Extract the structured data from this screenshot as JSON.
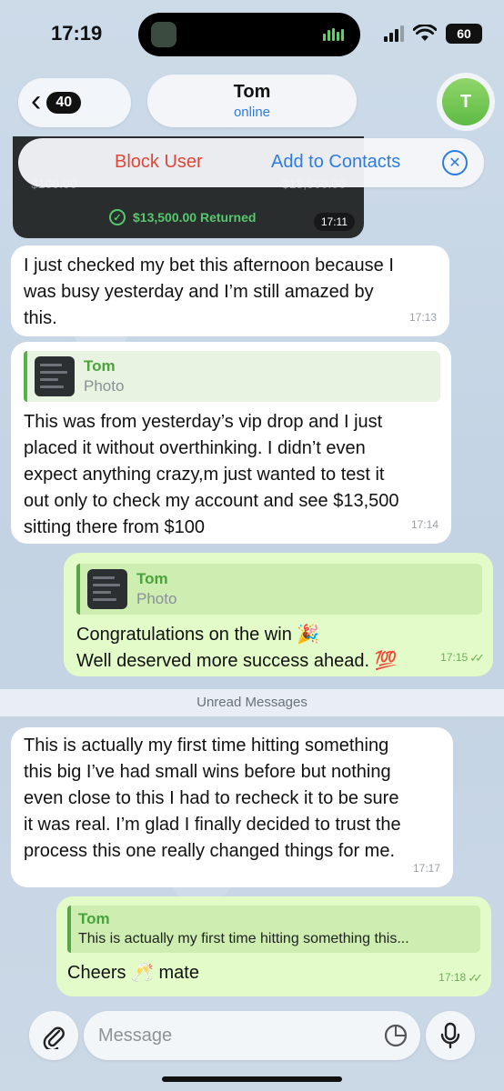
{
  "status_bar": {
    "time": "17:19",
    "battery": "60"
  },
  "header": {
    "back_count": "40",
    "name": "Tom",
    "status": "online",
    "avatar_initial": "T"
  },
  "actions": {
    "block": "Block User",
    "add": "Add to Contacts"
  },
  "photo_message": {
    "faded_left": "$100.00",
    "faded_right": "$13,500.00",
    "returned_text": "$13,500.00 Returned",
    "time": "17:11"
  },
  "messages": [
    {
      "direction": "incoming",
      "text": "I just checked my bet this afternoon because I\nwas busy yesterday and  I’m still amazed by\nthis.",
      "time": "17:13"
    },
    {
      "direction": "incoming",
      "reply": {
        "name": "Tom",
        "sub": "Photo"
      },
      "text": "This was from yesterday’s vip drop and I just\nplaced it without overthinking. I didn’t even\nexpect anything crazy,m just wanted to test it\nout only to check my account and see $13,500\nsitting there from $100",
      "time": "17:14"
    },
    {
      "direction": "outgoing",
      "reply": {
        "name": "Tom",
        "sub": "Photo"
      },
      "text": "Congratulations on the win 🎉\nWell deserved more success ahead. 💯",
      "time": "17:15"
    },
    {
      "direction": "incoming",
      "text": "This is actually my first time hitting something\nthis big I’ve had small wins before but nothing\neven close to this I had to recheck it to be sure\nit was real. I’m glad I finally decided to trust the\nprocess this one really changed things for me.",
      "time": "17:17"
    },
    {
      "direction": "outgoing",
      "reply": {
        "name": "Tom",
        "sub": "This is actually my first time hitting something this..."
      },
      "text": "Cheers 🥂 mate",
      "time": "17:18"
    }
  ],
  "unread_label": "Unread Messages",
  "input": {
    "placeholder": "Message"
  },
  "icons": [
    "back-chevron-icon",
    "close-icon",
    "check-circle-icon",
    "attach-icon",
    "sticker-icon",
    "microphone-icon",
    "double-check-icon"
  ],
  "colors": {
    "outgoing_bubble": "#e3fbc8",
    "incoming_bubble": "#ffffff",
    "link_blue": "#2d7de0",
    "danger_red": "#e0453a",
    "accent_green": "#4ba23c"
  }
}
